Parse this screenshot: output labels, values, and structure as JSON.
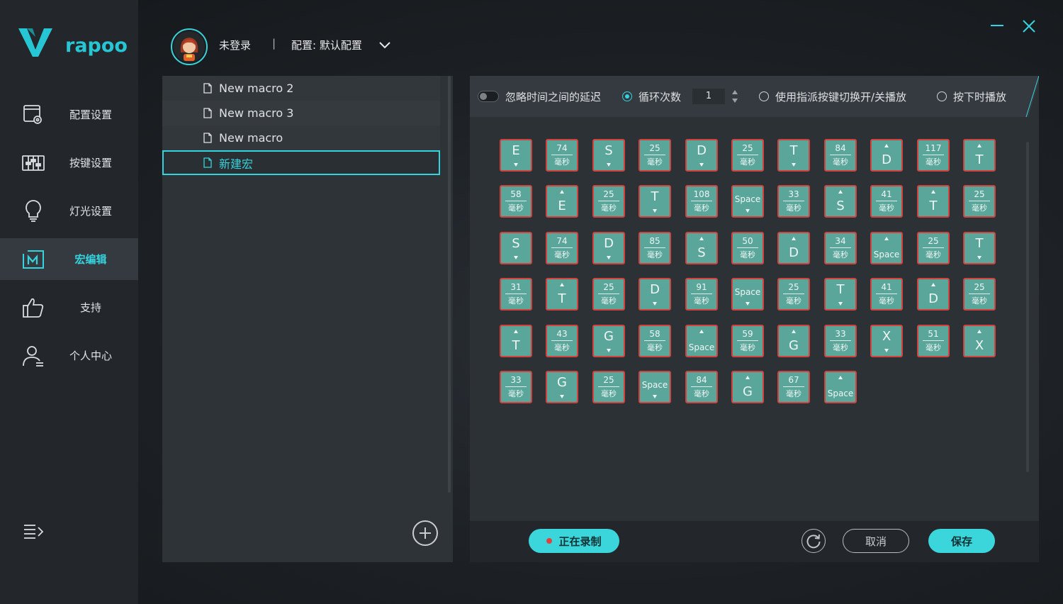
{
  "brand": {
    "name": "rapoo",
    "accent": "#35d3dd"
  },
  "header": {
    "user_status": "未登录",
    "divider": "|",
    "config_label": "配置: 默认配置"
  },
  "sidebar": {
    "items": [
      {
        "label": "配置设置",
        "icon": "config-icon",
        "active": false
      },
      {
        "label": "按键设置",
        "icon": "key-settings-icon",
        "active": false
      },
      {
        "label": "灯光设置",
        "icon": "lightbulb-icon",
        "active": false
      },
      {
        "label": "宏编辑",
        "icon": "macro-icon",
        "active": true
      },
      {
        "label": "支持",
        "icon": "thumbs-up-icon",
        "active": false
      },
      {
        "label": "个人中心",
        "icon": "user-center-icon",
        "active": false
      }
    ]
  },
  "macro_list": {
    "items": [
      {
        "name": "New macro 2",
        "selected": false
      },
      {
        "name": "New macro 3",
        "selected": false
      },
      {
        "name": "New macro",
        "selected": false
      },
      {
        "name": "新建宏",
        "selected": true
      }
    ]
  },
  "toolbar": {
    "ignore_delay_label": "忽略时间之间的延迟",
    "loop_count_label": "循环次数",
    "loop_count_value": "1",
    "toggle_assign_label": "使用指派按键切换开/关播放",
    "hold_play_label": "按下时播放"
  },
  "macro_steps": [
    {
      "t": "key",
      "k": "E",
      "d": "down"
    },
    {
      "t": "delay",
      "v": "74"
    },
    {
      "t": "key",
      "k": "S",
      "d": "down"
    },
    {
      "t": "delay",
      "v": "25"
    },
    {
      "t": "key",
      "k": "D",
      "d": "down"
    },
    {
      "t": "delay",
      "v": "25"
    },
    {
      "t": "key",
      "k": "T",
      "d": "down"
    },
    {
      "t": "delay",
      "v": "84"
    },
    {
      "t": "key",
      "k": "D",
      "d": "up"
    },
    {
      "t": "delay",
      "v": "117"
    },
    {
      "t": "key",
      "k": "T",
      "d": "up"
    },
    {
      "t": "delay",
      "v": "58"
    },
    {
      "t": "key",
      "k": "E",
      "d": "up"
    },
    {
      "t": "delay",
      "v": "25"
    },
    {
      "t": "key",
      "k": "T",
      "d": "down"
    },
    {
      "t": "delay",
      "v": "108"
    },
    {
      "t": "key",
      "k": "Space",
      "d": "down"
    },
    {
      "t": "delay",
      "v": "33"
    },
    {
      "t": "key",
      "k": "S",
      "d": "up"
    },
    {
      "t": "delay",
      "v": "41"
    },
    {
      "t": "key",
      "k": "T",
      "d": "up"
    },
    {
      "t": "delay",
      "v": "25"
    },
    {
      "t": "key",
      "k": "S",
      "d": "down"
    },
    {
      "t": "delay",
      "v": "74"
    },
    {
      "t": "key",
      "k": "D",
      "d": "down"
    },
    {
      "t": "delay",
      "v": "85"
    },
    {
      "t": "key",
      "k": "S",
      "d": "up"
    },
    {
      "t": "delay",
      "v": "50"
    },
    {
      "t": "key",
      "k": "D",
      "d": "up"
    },
    {
      "t": "delay",
      "v": "34"
    },
    {
      "t": "key",
      "k": "Space",
      "d": "up"
    },
    {
      "t": "delay",
      "v": "25"
    },
    {
      "t": "key",
      "k": "T",
      "d": "down"
    },
    {
      "t": "delay",
      "v": "31"
    },
    {
      "t": "key",
      "k": "T",
      "d": "up"
    },
    {
      "t": "delay",
      "v": "25"
    },
    {
      "t": "key",
      "k": "D",
      "d": "down"
    },
    {
      "t": "delay",
      "v": "91"
    },
    {
      "t": "key",
      "k": "Space",
      "d": "down"
    },
    {
      "t": "delay",
      "v": "25"
    },
    {
      "t": "key",
      "k": "T",
      "d": "down"
    },
    {
      "t": "delay",
      "v": "41"
    },
    {
      "t": "key",
      "k": "D",
      "d": "up"
    },
    {
      "t": "delay",
      "v": "25"
    },
    {
      "t": "key",
      "k": "T",
      "d": "up"
    },
    {
      "t": "delay",
      "v": "43"
    },
    {
      "t": "key",
      "k": "G",
      "d": "down"
    },
    {
      "t": "delay",
      "v": "58"
    },
    {
      "t": "key",
      "k": "Space",
      "d": "up"
    },
    {
      "t": "delay",
      "v": "59"
    },
    {
      "t": "key",
      "k": "G",
      "d": "up"
    },
    {
      "t": "delay",
      "v": "33"
    },
    {
      "t": "key",
      "k": "X",
      "d": "down"
    },
    {
      "t": "delay",
      "v": "51"
    },
    {
      "t": "key",
      "k": "X",
      "d": "up"
    },
    {
      "t": "delay",
      "v": "33"
    },
    {
      "t": "key",
      "k": "G",
      "d": "down"
    },
    {
      "t": "delay",
      "v": "25"
    },
    {
      "t": "key",
      "k": "Space",
      "d": "down"
    },
    {
      "t": "delay",
      "v": "84"
    },
    {
      "t": "key",
      "k": "G",
      "d": "up"
    },
    {
      "t": "delay",
      "v": "67"
    },
    {
      "t": "key",
      "k": "Space",
      "d": "up"
    }
  ],
  "delay_unit": "毫秒",
  "footer": {
    "record_label": "正在录制",
    "cancel_label": "取消",
    "save_label": "保存"
  }
}
